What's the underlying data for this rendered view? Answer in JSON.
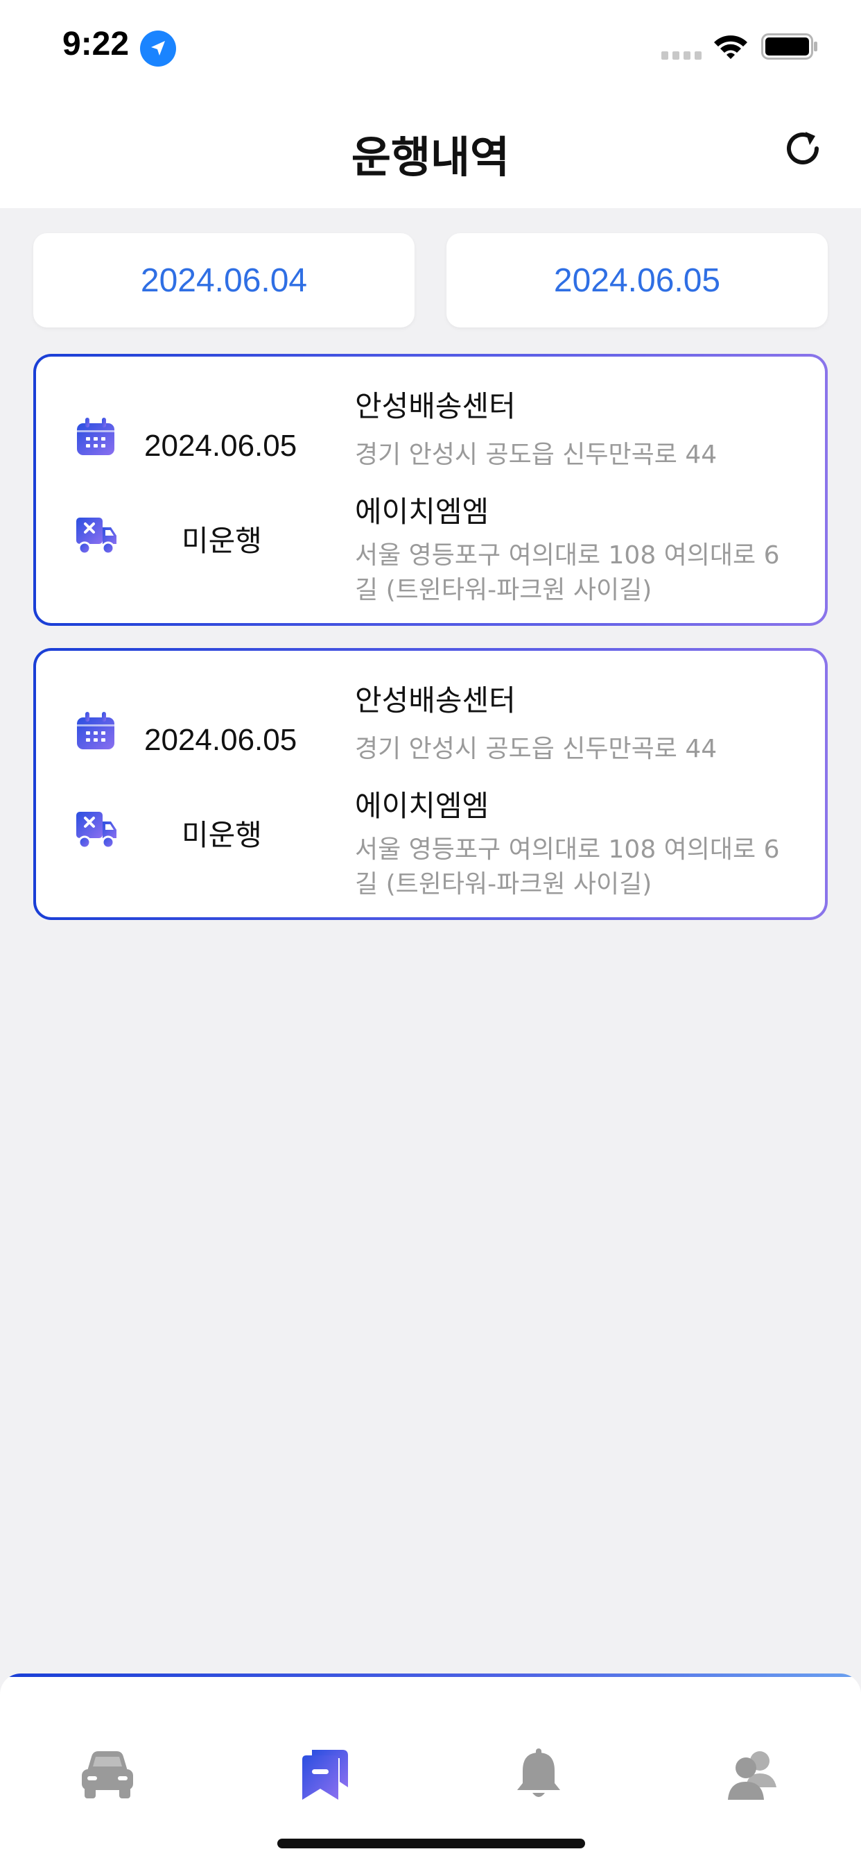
{
  "status_bar": {
    "time": "9:22"
  },
  "header": {
    "title": "운행내역"
  },
  "date_range": {
    "start": "2024.06.04",
    "end": "2024.06.05"
  },
  "records": [
    {
      "date": "2024.06.05",
      "status": "미운행",
      "origin_name": "안성배송센터",
      "origin_address": "경기 안성시 공도읍 신두만곡로 44",
      "destination_name": "에이치엠엠",
      "destination_address": "서울 영등포구 여의대로 108 여의대로 6길 (트윈타워-파크원 사이길)"
    },
    {
      "date": "2024.06.05",
      "status": "미운행",
      "origin_name": "안성배송센터",
      "origin_address": "경기 안성시 공도읍 신두만곡로 44",
      "destination_name": "에이치엠엠",
      "destination_address": "서울 영등포구 여의대로 108 여의대로 6길 (트윈타워-파크원 사이길)"
    }
  ],
  "bottom_nav": {
    "items": [
      {
        "icon": "car-icon",
        "active": false
      },
      {
        "icon": "history-icon",
        "active": true
      },
      {
        "icon": "bell-icon",
        "active": false
      },
      {
        "icon": "users-icon",
        "active": false
      }
    ]
  },
  "colors": {
    "accent": "#2f6fe4",
    "card_border_start": "#1a3fd6",
    "card_border_end": "#8a74ea",
    "inactive_icon": "#9a9a9a"
  }
}
